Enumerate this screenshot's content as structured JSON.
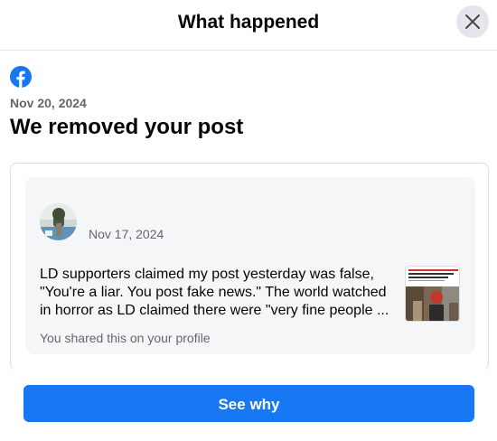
{
  "header": {
    "title": "What happened",
    "close_icon": "close-icon"
  },
  "brand": {
    "icon": "facebook-logo-icon",
    "color": "#1877f2"
  },
  "notice": {
    "date": "Nov 20, 2024",
    "title": "We removed your post"
  },
  "post": {
    "avatar_icon": "profile-avatar",
    "date": "Nov 17, 2024",
    "text": "LD supporters claimed my post yesterday was false,\n\"You're a liar. You post fake news.\" The world watched\nin horror as LD claimed there were \"very fine people ...",
    "meta": "You shared this on your profile",
    "thumbnail_icon": "article-thumbnail"
  },
  "actions": {
    "see_why_label": "See why"
  },
  "colors": {
    "accent": "#1877f2",
    "secondary_text": "#65676b",
    "card_bg": "#f5f6f7"
  }
}
